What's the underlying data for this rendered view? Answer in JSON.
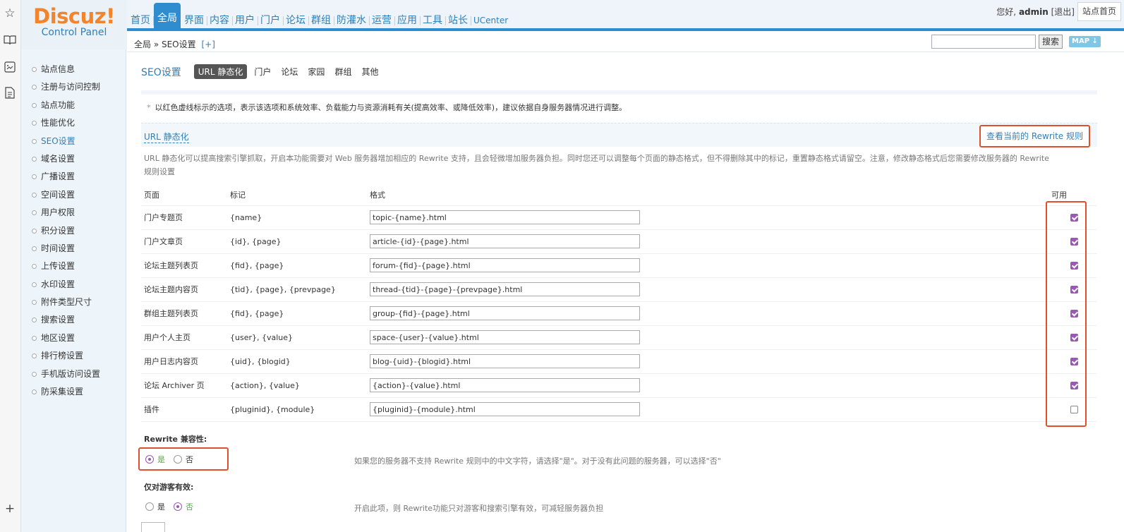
{
  "header": {
    "logo_main": "Discuz!",
    "logo_sub": "Control Panel",
    "nav": [
      "首页",
      "全局",
      "界面",
      "内容",
      "用户",
      "门户",
      "论坛",
      "群组",
      "防灌水",
      "运营",
      "应用",
      "工具",
      "站长",
      "UCenter"
    ],
    "active_nav": "全局",
    "greeting": "您好,",
    "username": "admin",
    "logout": "[退出]",
    "site_home": "站点首页"
  },
  "breadcrumb": {
    "text": "全局 » SEO设置",
    "plus": "[+]",
    "search_button": "搜索",
    "map_button": "MAP ↓"
  },
  "sidebar": {
    "items": [
      "站点信息",
      "注册与访问控制",
      "站点功能",
      "性能优化",
      "SEO设置",
      "域名设置",
      "广播设置",
      "空间设置",
      "用户权限",
      "积分设置",
      "时间设置",
      "上传设置",
      "水印设置",
      "附件类型尺寸",
      "搜索设置",
      "地区设置",
      "排行榜设置",
      "手机版访问设置",
      "防采集设置"
    ],
    "active": "SEO设置"
  },
  "main": {
    "title": "SEO设置",
    "tabs": [
      "URL 静态化",
      "门户",
      "论坛",
      "家园",
      "群组",
      "其他"
    ],
    "tip_star": "*",
    "tip": "以红色虚线标示的选项，表示该选项和系统效率、负载能力与资源消耗有关(提高效率、或降低效率)，建议依据自身服务器情况进行调整。",
    "section_title": "URL 静态化",
    "rewrite_link": "查看当前的 Rewrite 规则",
    "description": "URL 静态化可以提高搜索引擎抓取，开启本功能需要对 Web 服务器增加相应的 Rewrite 支持，且会轻微增加服务器负担。同时您还可以调整每个页面的静态格式，但不得删除其中的标记，重置静态格式请留空。注意，修改静态格式后您需要修改服务器的 Rewrite 规则设置",
    "table": {
      "headers": {
        "page": "页面",
        "mark": "标记",
        "format": "格式",
        "enable": "可用"
      },
      "rows": [
        {
          "page": "门户专题页",
          "mark": "{name}",
          "format": "topic-{name}.html",
          "enabled": true
        },
        {
          "page": "门户文章页",
          "mark": "{id}, {page}",
          "format": "article-{id}-{page}.html",
          "enabled": true
        },
        {
          "page": "论坛主题列表页",
          "mark": "{fid}, {page}",
          "format": "forum-{fid}-{page}.html",
          "enabled": true
        },
        {
          "page": "论坛主题内容页",
          "mark": "{tid}, {page}, {prevpage}",
          "format": "thread-{tid}-{page}-{prevpage}.html",
          "enabled": true
        },
        {
          "page": "群组主题列表页",
          "mark": "{fid}, {page}",
          "format": "group-{fid}-{page}.html",
          "enabled": true
        },
        {
          "page": "用户个人主页",
          "mark": "{user}, {value}",
          "format": "space-{user}-{value}.html",
          "enabled": true
        },
        {
          "page": "用户日志内容页",
          "mark": "{uid}, {blogid}",
          "format": "blog-{uid}-{blogid}.html",
          "enabled": true
        },
        {
          "page": "论坛 Archiver 页",
          "mark": "{action}, {value}",
          "format": "{action}-{value}.html",
          "enabled": true
        },
        {
          "page": "插件",
          "mark": "{pluginid}, {module}",
          "format": "{pluginid}-{module}.html",
          "enabled": false
        }
      ]
    },
    "rewrite_compat": {
      "label": "Rewrite 兼容性:",
      "yes": "是",
      "no": "否",
      "selected": "yes",
      "desc": "如果您的服务器不支持 Rewrite 规则中的中文字符，请选择\"是\"。对于没有此问题的服务器，可以选择\"否\""
    },
    "guest_only": {
      "label": "仅对游客有效:",
      "yes": "是",
      "no": "否",
      "selected": "no",
      "desc": "开启此项，则 Rewrite功能只对游客和搜索引擎有效，可减轻服务器负担"
    }
  },
  "icons": {
    "strip": [
      "star-icon",
      "book-icon",
      "screenshot-icon",
      "note-icon",
      "plus-icon"
    ]
  },
  "colors": {
    "accent": "#2f8ccf",
    "logo_orange": "#f2852b",
    "highlight_red": "#e0502e",
    "check_purple": "#9b57b5"
  }
}
